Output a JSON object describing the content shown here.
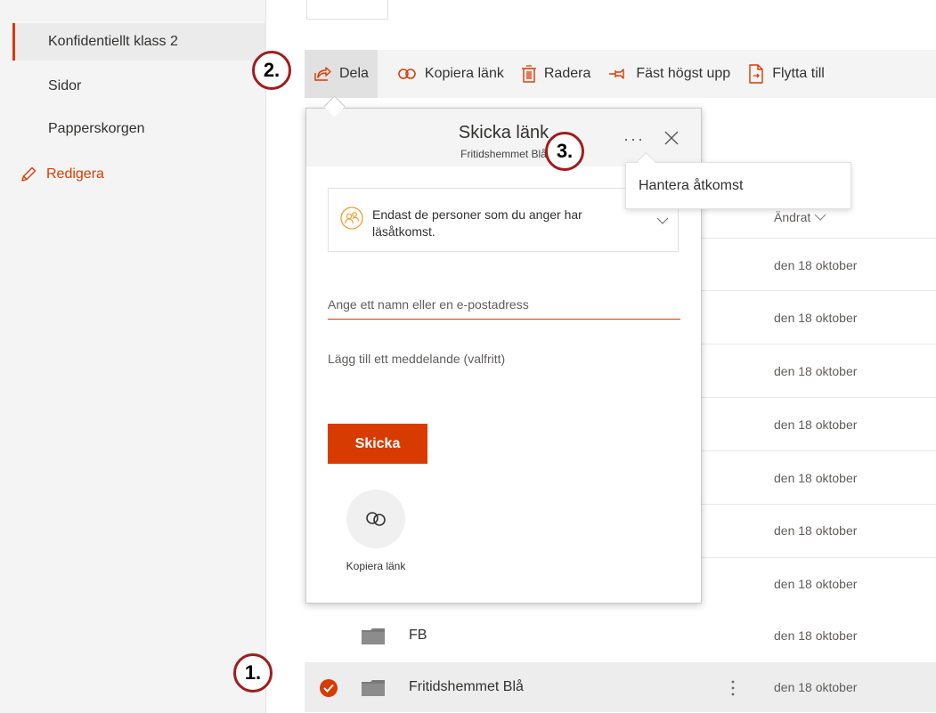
{
  "left_nav": {
    "items": [
      {
        "label": "Konfidentiellt klass 2",
        "selected": true
      },
      {
        "label": "Sidor"
      },
      {
        "label": "Papperskorgen"
      }
    ],
    "edit_label": "Redigera",
    "edit_icon": "pencil-icon"
  },
  "command_bar": {
    "share": "Dela",
    "copy_link": "Kopiera länk",
    "delete": "Radera",
    "pin": "Fäst högst upp",
    "move": "Flytta till"
  },
  "list": {
    "modified_header": "Ändrat",
    "dates": [
      "den 18 oktober",
      "den 18 oktober",
      "den 18 oktober",
      "den 18 oktober",
      "den 18 oktober",
      "den 18 oktober",
      "den 18 oktober"
    ],
    "rows": [
      {
        "name": "FB",
        "date": "den 18 oktober"
      },
      {
        "name": "Fritidshemmet Blå",
        "date": "den 18 oktober",
        "selected": true
      }
    ]
  },
  "share_dialog": {
    "title": "Skicka länk",
    "subtitle": "Fritidshemmet Blå",
    "more": "···",
    "permission_text": "Endast de personer som du anger har läsåtkomst.",
    "recipient_placeholder": "Ange ett namn eller en e-postadress",
    "message_placeholder": "Lägg till ett meddelande (valfritt)",
    "send": "Skicka",
    "copy_link": "Kopiera länk"
  },
  "access_menu": {
    "manage_access": "Hantera åtkomst"
  },
  "markers": [
    "1.",
    "2.",
    "3."
  ],
  "colors": {
    "accent": "#d83b01",
    "marker_border": "#a01d1d",
    "nav_bg": "#f4f4f4"
  }
}
